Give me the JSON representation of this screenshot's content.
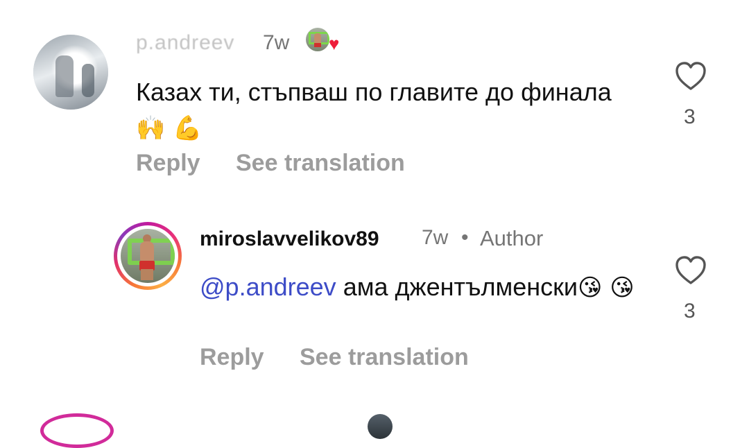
{
  "comments": [
    {
      "username": "p.andreev",
      "time": "7w",
      "text": "Казах ти, стъпваш по главите до финала",
      "emojis": "🙌 💪",
      "reply_label": "Reply",
      "translate_label": "See translation",
      "likes": "3"
    },
    {
      "username": "miroslavvelikov89",
      "time": "7w",
      "separator": "•",
      "badge": "Author",
      "mention": "@p.andreev",
      "text": "ама джентълменски",
      "emojis": "😘 😘",
      "reply_label": "Reply",
      "translate_label": "See translation",
      "likes": "3"
    }
  ],
  "icons": {
    "like": "heart-outline-icon",
    "liked_by_author": "heart-filled-icon"
  },
  "colors": {
    "mention": "#3d4cc7",
    "secondary_text": "#757575",
    "action_text": "#9c9c9c",
    "heart_red": "#ee1d3a"
  }
}
